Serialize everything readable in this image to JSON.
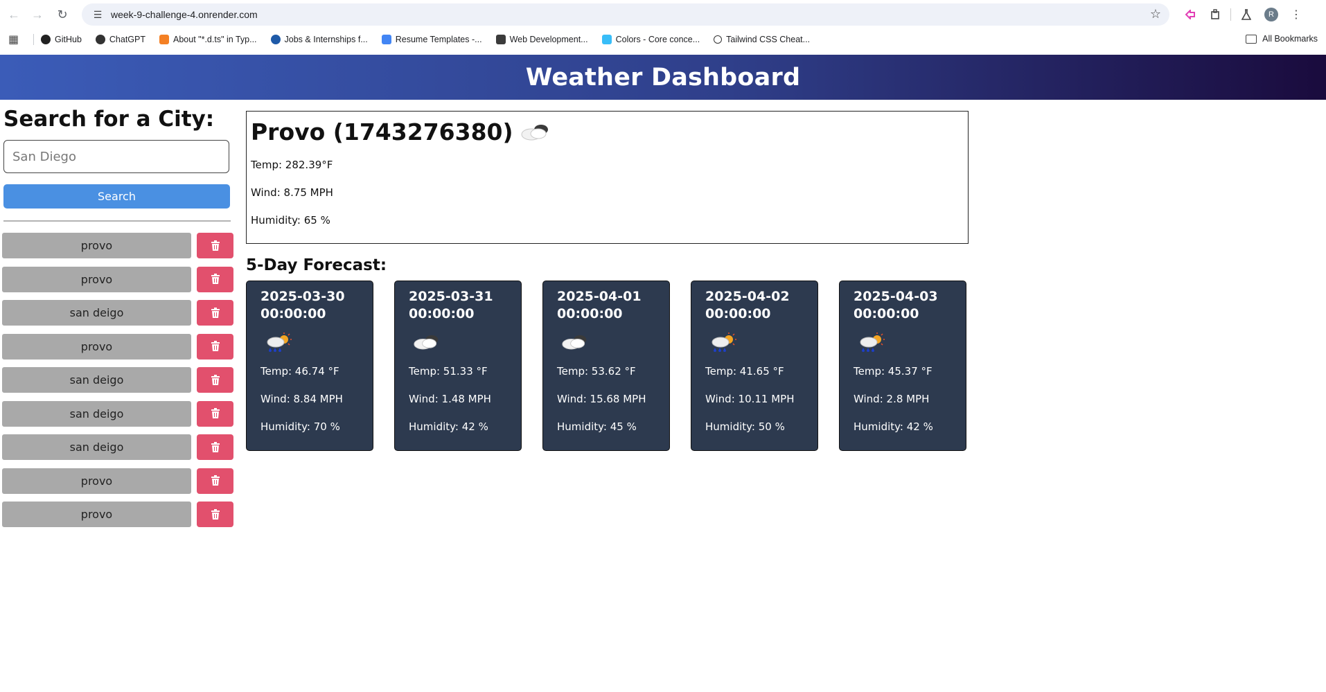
{
  "browser": {
    "url": "week-9-challenge-4.onrender.com",
    "avatar_letter": "R",
    "bookmarks": [
      {
        "label": "GitHub",
        "icon": "github-icon"
      },
      {
        "label": "ChatGPT",
        "icon": "chatgpt-icon"
      },
      {
        "label": "About \"*.d.ts\" in Typ...",
        "icon": "stackoverflow-icon"
      },
      {
        "label": "Jobs & Internships f...",
        "icon": "handshake-icon"
      },
      {
        "label": "Resume Templates -...",
        "icon": "docs-icon"
      },
      {
        "label": "Web Development...",
        "icon": "web-icon"
      },
      {
        "label": "Colors - Core conce...",
        "icon": "tailwind-icon"
      },
      {
        "label": "Tailwind CSS Cheat...",
        "icon": "search-icon"
      }
    ],
    "all_bookmarks": "All Bookmarks"
  },
  "header": {
    "title": "Weather Dashboard"
  },
  "search": {
    "title": "Search for a City:",
    "placeholder": "San Diego",
    "button_label": "Search"
  },
  "history": [
    "provo",
    "provo",
    "san deigo",
    "provo",
    "san deigo",
    "san deigo",
    "san deigo",
    "provo",
    "provo"
  ],
  "current": {
    "title": "Provo (1743276380)",
    "icon": "cloudy-icon",
    "temp": "Temp: 282.39°F",
    "wind": "Wind: 8.75 MPH",
    "humidity": "Humidity: 65 %"
  },
  "forecast": {
    "title": "5-Day Forecast:",
    "days": [
      {
        "date": "2025-03-30 00:00:00",
        "icon": "rain-sun-icon",
        "temp": "Temp: 46.74 °F",
        "wind": "Wind: 8.84 MPH",
        "humidity": "Humidity: 70 %"
      },
      {
        "date": "2025-03-31 00:00:00",
        "icon": "cloudy-icon",
        "temp": "Temp: 51.33 °F",
        "wind": "Wind: 1.48 MPH",
        "humidity": "Humidity: 42 %"
      },
      {
        "date": "2025-04-01 00:00:00",
        "icon": "cloudy-icon",
        "temp": "Temp: 53.62 °F",
        "wind": "Wind: 15.68 MPH",
        "humidity": "Humidity: 45 %"
      },
      {
        "date": "2025-04-02 00:00:00",
        "icon": "rain-sun-icon",
        "temp": "Temp: 41.65 °F",
        "wind": "Wind: 10.11 MPH",
        "humidity": "Humidity: 50 %"
      },
      {
        "date": "2025-04-03 00:00:00",
        "icon": "rain-sun-icon",
        "temp": "Temp: 45.37 °F",
        "wind": "Wind: 2.8 MPH",
        "humidity": "Humidity: 42 %"
      }
    ]
  },
  "colors": {
    "header_start": "#3b5cb8",
    "header_end": "#1a0b3d",
    "search_button": "#4a90e2",
    "history_button": "#a9a9a9",
    "delete_button": "#e2506d",
    "card_bg": "#2d3a4f"
  }
}
